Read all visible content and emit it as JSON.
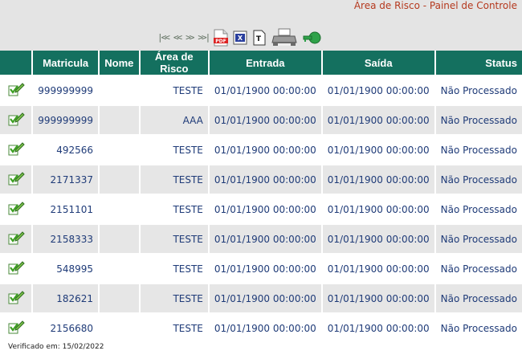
{
  "page": {
    "title": "Área de Risco - Painel de Controle"
  },
  "toolbar": {
    "nav": [
      {
        "name": "first-page-button",
        "label": "|<<"
      },
      {
        "name": "previous-page-button",
        "label": "<<"
      },
      {
        "name": "next-page-button",
        "label": ">>"
      },
      {
        "name": "last-page-button",
        "label": ">>|"
      }
    ],
    "tools": [
      {
        "name": "export-pdf-button",
        "icon": "pdf-icon",
        "label": "PDF"
      },
      {
        "name": "export-excel-button",
        "icon": "excel-icon",
        "label": "X"
      },
      {
        "name": "export-text-button",
        "icon": "text-file-icon",
        "label": "T"
      },
      {
        "name": "print-button",
        "icon": "printer-icon"
      },
      {
        "name": "refresh-button",
        "icon": "green-key-icon"
      }
    ]
  },
  "table": {
    "headers": [
      "",
      "Matricula",
      "Nome",
      "Área de Risco",
      "Entrada",
      "Saída",
      "Status"
    ],
    "rows": [
      {
        "matricula": "999999999",
        "nome": "",
        "area": "TESTE",
        "entrada": "01/01/1900 00:00:00",
        "saida": "01/01/1900 00:00:00",
        "status": "Não Processado"
      },
      {
        "matricula": "999999999",
        "nome": "",
        "area": "AAA",
        "entrada": "01/01/1900 00:00:00",
        "saida": "01/01/1900 00:00:00",
        "status": "Não Processado"
      },
      {
        "matricula": "492566",
        "nome": "",
        "area": "TESTE",
        "entrada": "01/01/1900 00:00:00",
        "saida": "01/01/1900 00:00:00",
        "status": "Não Processado"
      },
      {
        "matricula": "2171337",
        "nome": "",
        "area": "TESTE",
        "entrada": "01/01/1900 00:00:00",
        "saida": "01/01/1900 00:00:00",
        "status": "Não Processado"
      },
      {
        "matricula": "2151101",
        "nome": "",
        "area": "TESTE",
        "entrada": "01/01/1900 00:00:00",
        "saida": "01/01/1900 00:00:00",
        "status": "Não Processado"
      },
      {
        "matricula": "2158333",
        "nome": "",
        "area": "TESTE",
        "entrada": "01/01/1900 00:00:00",
        "saida": "01/01/1900 00:00:00",
        "status": "Não Processado"
      },
      {
        "matricula": "548995",
        "nome": "",
        "area": "TESTE",
        "entrada": "01/01/1900 00:00:00",
        "saida": "01/01/1900 00:00:00",
        "status": "Não Processado"
      },
      {
        "matricula": "182621",
        "nome": "",
        "area": "TESTE",
        "entrada": "01/01/1900 00:00:00",
        "saida": "01/01/1900 00:00:00",
        "status": "Não Processado"
      },
      {
        "matricula": "2156680",
        "nome": "",
        "area": "TESTE",
        "entrada": "01/01/1900 00:00:00",
        "saida": "01/01/1900 00:00:00",
        "status": "Não Processado"
      }
    ]
  },
  "footer": {
    "verified": "Verificado em: 15/02/2022"
  },
  "colors": {
    "header": "#14705f",
    "title": "#b5391e",
    "cell_text": "#1f3b78",
    "band": "#e4e4e4"
  }
}
